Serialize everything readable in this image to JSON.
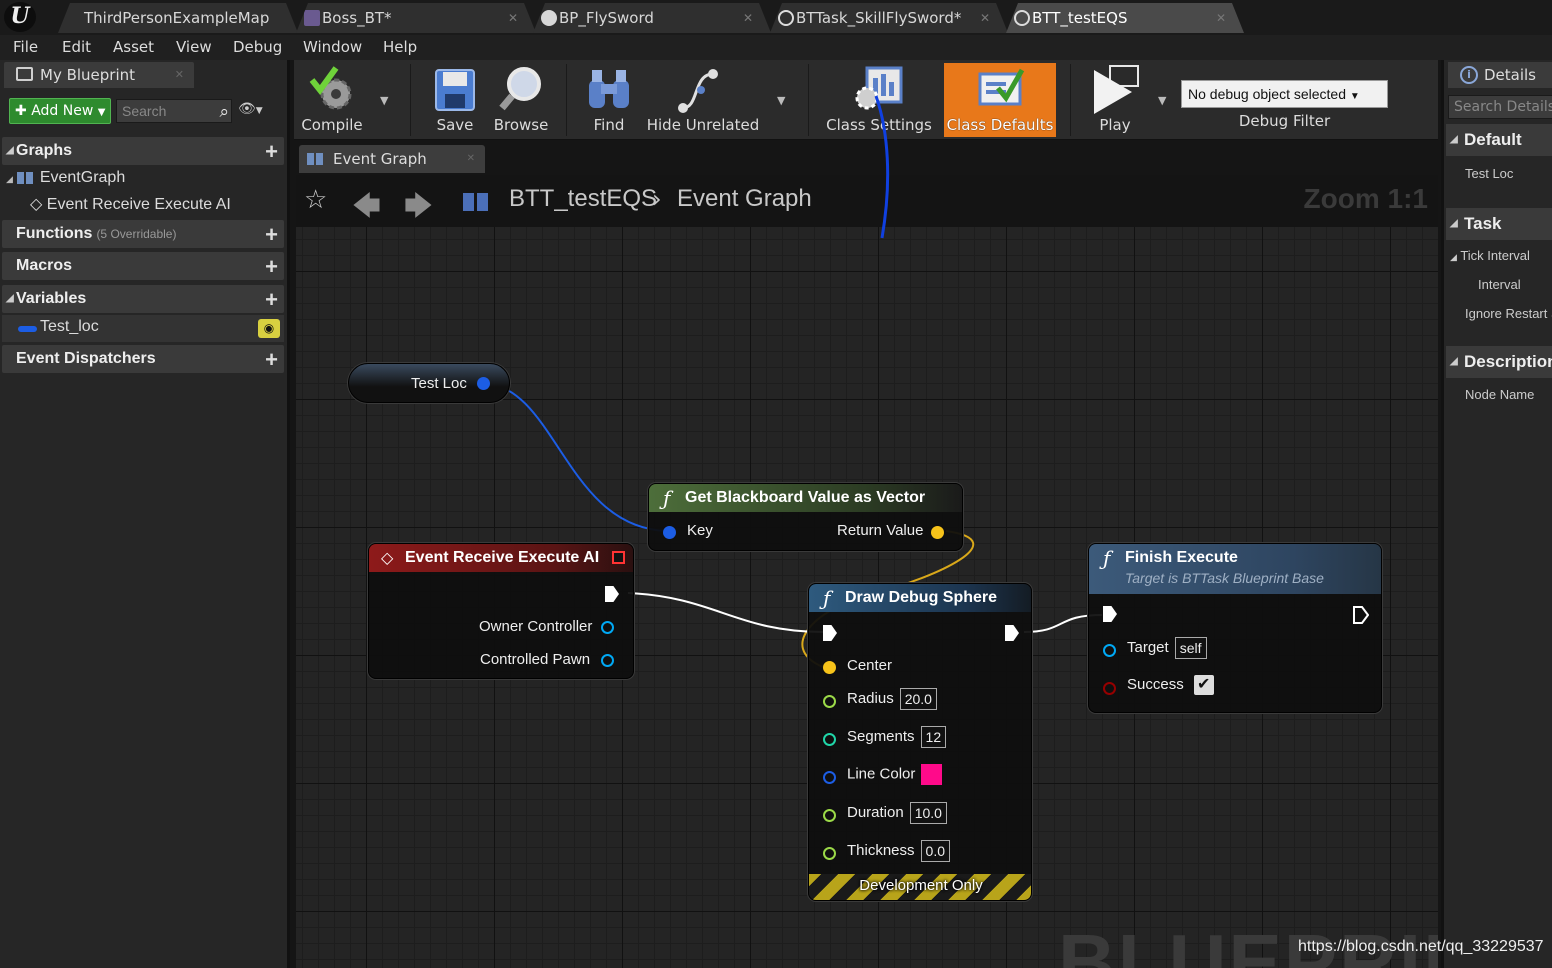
{
  "document_tabs": [
    {
      "label": "ThirdPersonExampleMap",
      "icon": "level-icon"
    },
    {
      "label": "Boss_BT*",
      "icon": "behavior-tree-icon"
    },
    {
      "label": "BP_FlySword",
      "icon": "blueprint-icon"
    },
    {
      "label": "BTTask_SkillFlySword*",
      "icon": "blueprint-icon"
    },
    {
      "label": "BTT_testEQS",
      "icon": "blueprint-icon"
    }
  ],
  "menu": [
    "File",
    "Edit",
    "Asset",
    "View",
    "Debug",
    "Window",
    "Help"
  ],
  "my_blueprint": {
    "tab_label": "My Blueprint",
    "add_new_label": "Add New",
    "search_placeholder": "Search",
    "sections": {
      "graphs": "Graphs",
      "functions": "Functions",
      "functions_sub": "(5 Overridable)",
      "macros": "Macros",
      "variables": "Variables",
      "event_dispatchers": "Event Dispatchers"
    },
    "graph_items": [
      "EventGraph",
      "Event Receive Execute AI"
    ],
    "variable_items": [
      "Test_loc"
    ]
  },
  "toolbar": {
    "compile": "Compile",
    "save": "Save",
    "browse": "Browse",
    "find": "Find",
    "hide_unrelated": "Hide Unrelated",
    "class_settings": "Class Settings",
    "class_defaults": "Class Defaults",
    "play": "Play",
    "debug_object": "No debug object selected",
    "debug_filter": "Debug Filter"
  },
  "graph_tab": {
    "label": "Event Graph"
  },
  "breadcrumb": {
    "root": "BTT_testEQS",
    "current": "Event Graph"
  },
  "zoom_label": "Zoom 1:1",
  "watermark": "BLUEPRINT",
  "nodes": {
    "test_loc": {
      "title": "Test Loc"
    },
    "get_blackboard": {
      "title": "Get Blackboard Value as Vector",
      "key": "Key",
      "return": "Return Value"
    },
    "event_receive": {
      "title": "Event Receive Execute AI",
      "owner": "Owner Controller",
      "pawn": "Controlled Pawn"
    },
    "draw_sphere": {
      "title": "Draw Debug Sphere",
      "center": "Center",
      "radius": "Radius",
      "radius_val": "20.0",
      "segments": "Segments",
      "segments_val": "12",
      "line_color": "Line Color",
      "duration": "Duration",
      "duration_val": "10.0",
      "thickness": "Thickness",
      "thickness_val": "0.0",
      "footer": "Development Only"
    },
    "finish_execute": {
      "title": "Finish Execute",
      "subtitle": "Target is BTTask Blueprint Base",
      "target": "Target",
      "target_val": "self",
      "success": "Success"
    }
  },
  "details": {
    "tab_label": "Details",
    "search_placeholder": "Search Details",
    "categories": [
      "Default",
      "Task",
      "Description"
    ],
    "default_props": [
      "Test Loc"
    ],
    "task_props": [
      "Tick Interval",
      "Interval",
      "Ignore Restart S"
    ],
    "description_props": [
      "Node Name"
    ]
  },
  "url_watermark": "https://blog.csdn.net/qq_33229537",
  "colors": {
    "class_defaults_active": "#e8781a",
    "vector_pin": "#f7c31a",
    "struct_pin": "#1c5de4",
    "float_pin": "#9bd948",
    "int_pin": "#20d5a8",
    "bool_pin": "#950000",
    "line_color_swatch": "#ff0a8a"
  }
}
